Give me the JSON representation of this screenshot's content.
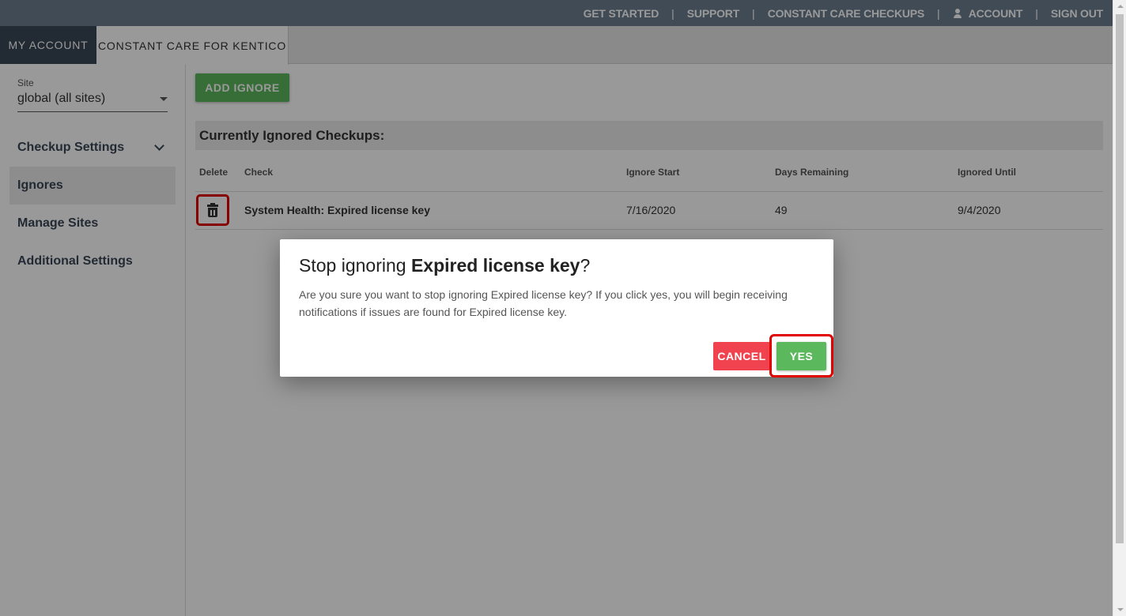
{
  "topnav": {
    "get_started": "GET STARTED",
    "support": "SUPPORT",
    "checkups": "CONSTANT CARE CHECKUPS",
    "account": "ACCOUNT",
    "sign_out": "SIGN OUT",
    "separator": "|"
  },
  "tabs": {
    "my_account": "MY ACCOUNT",
    "constant_care": "CONSTANT CARE FOR KENTICO"
  },
  "sidebar": {
    "site_label": "Site",
    "site_value": "global (all sites)",
    "items": [
      {
        "label": "Checkup Settings"
      },
      {
        "label": "Ignores"
      },
      {
        "label": "Manage Sites"
      },
      {
        "label": "Additional Settings"
      }
    ]
  },
  "main": {
    "add_ignore": "ADD IGNORE",
    "section_title": "Currently Ignored Checkups:",
    "columns": [
      "Delete",
      "Check",
      "Ignore Start",
      "Days Remaining",
      "Ignored Until"
    ],
    "rows": [
      {
        "check": "System Health: Expired license key",
        "ignore_start": "7/16/2020",
        "days_remaining": "49",
        "ignored_until": "9/4/2020"
      }
    ]
  },
  "modal": {
    "title_prefix": "Stop ignoring ",
    "title_bold": "Expired license key",
    "title_suffix": "?",
    "body": "Are you sure you want to stop ignoring Expired license key? If you click yes, you will begin receiving notifications if issues are found for Expired license key.",
    "cancel": "CANCEL",
    "yes": "YES"
  },
  "colors": {
    "topbar": "#6b7d8f",
    "dark_tab": "#3a4756",
    "primary_green": "#5cb85c",
    "danger_red": "#f0434f",
    "highlight": "#e00000"
  }
}
